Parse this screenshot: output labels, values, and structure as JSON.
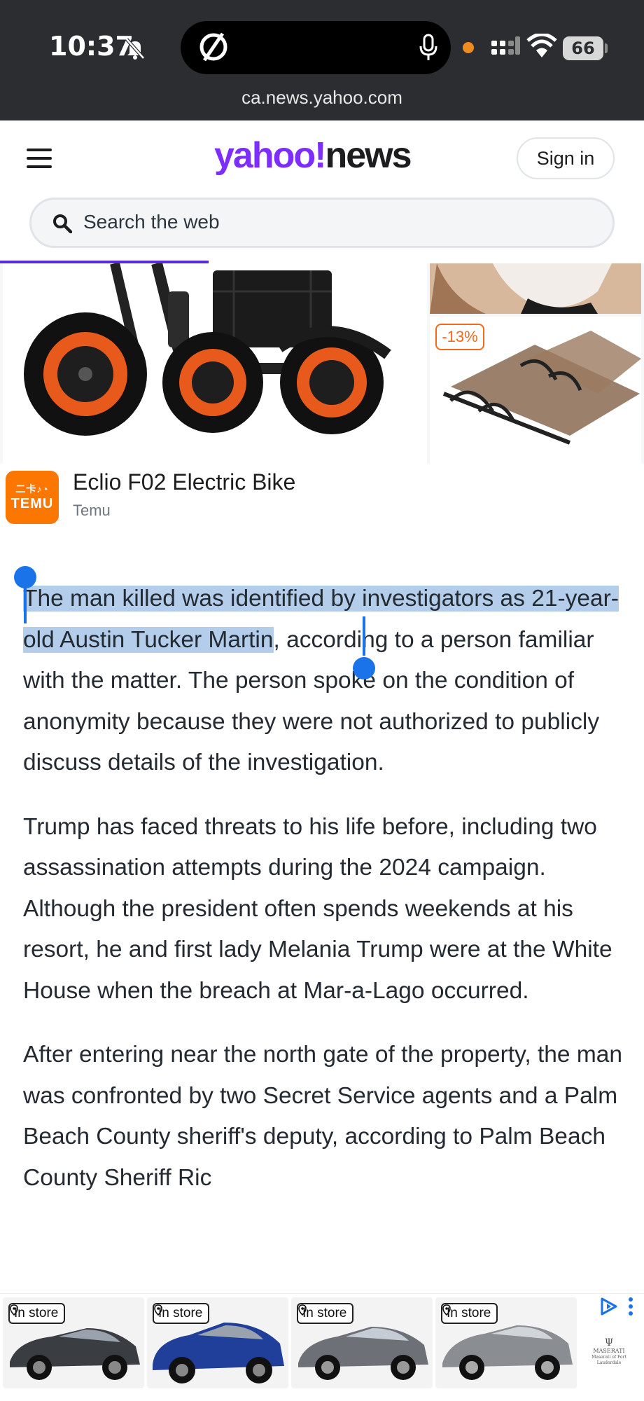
{
  "status_bar": {
    "time": "10:37",
    "battery": "66",
    "url": "ca.news.yahoo.com",
    "icons": [
      "bell-slash-icon",
      "nothing-glyph-icon",
      "mic-icon",
      "recording-dot",
      "signal-icon",
      "wifi-icon",
      "battery-icon"
    ]
  },
  "header": {
    "logo_yahoo": "yahoo",
    "logo_slash": "!",
    "logo_news": "news",
    "sign_in": "Sign in",
    "search_placeholder": "Search the web"
  },
  "ad": {
    "discount": "-13%",
    "title": "Eclio F02 Electric Bike",
    "advertiser": "Temu",
    "logo_text": "TEMU",
    "logo_glyphs": "二卡♪◔"
  },
  "article": {
    "p1_selected": "The man killed was identified by investigators as 21-year-old Austin Tucker Martin",
    "p1_rest": ", according to a person familiar with the matter. The person spoke on the condition of anonymity because they were not authorized to publicly discuss details of the investigation.",
    "p2": "Trump has faced threats to his life before, including two assassination attempts during the 2024 campaign. Although the president often spends weekends at his resort, he and first lady Melania Trump were at the White House when the breach at Mar-a-Lago occurred.",
    "p3": "After entering near the north gate of the property, the man was confronted by two Secret Service agents and a Palm Beach County sheriff's deputy, according to Palm Beach County Sheriff Ric"
  },
  "bottom_ad": {
    "cards": [
      {
        "badge": "In store",
        "color": "#3a3d42"
      },
      {
        "badge": "In store",
        "color": "#1f3f9a"
      },
      {
        "badge": "In store",
        "color": "#6d7177"
      },
      {
        "badge": "In store",
        "color": "#8a8e93"
      }
    ],
    "brand": "MASERATI",
    "brand_sub": "Maserati of Fort Lauderdale"
  }
}
